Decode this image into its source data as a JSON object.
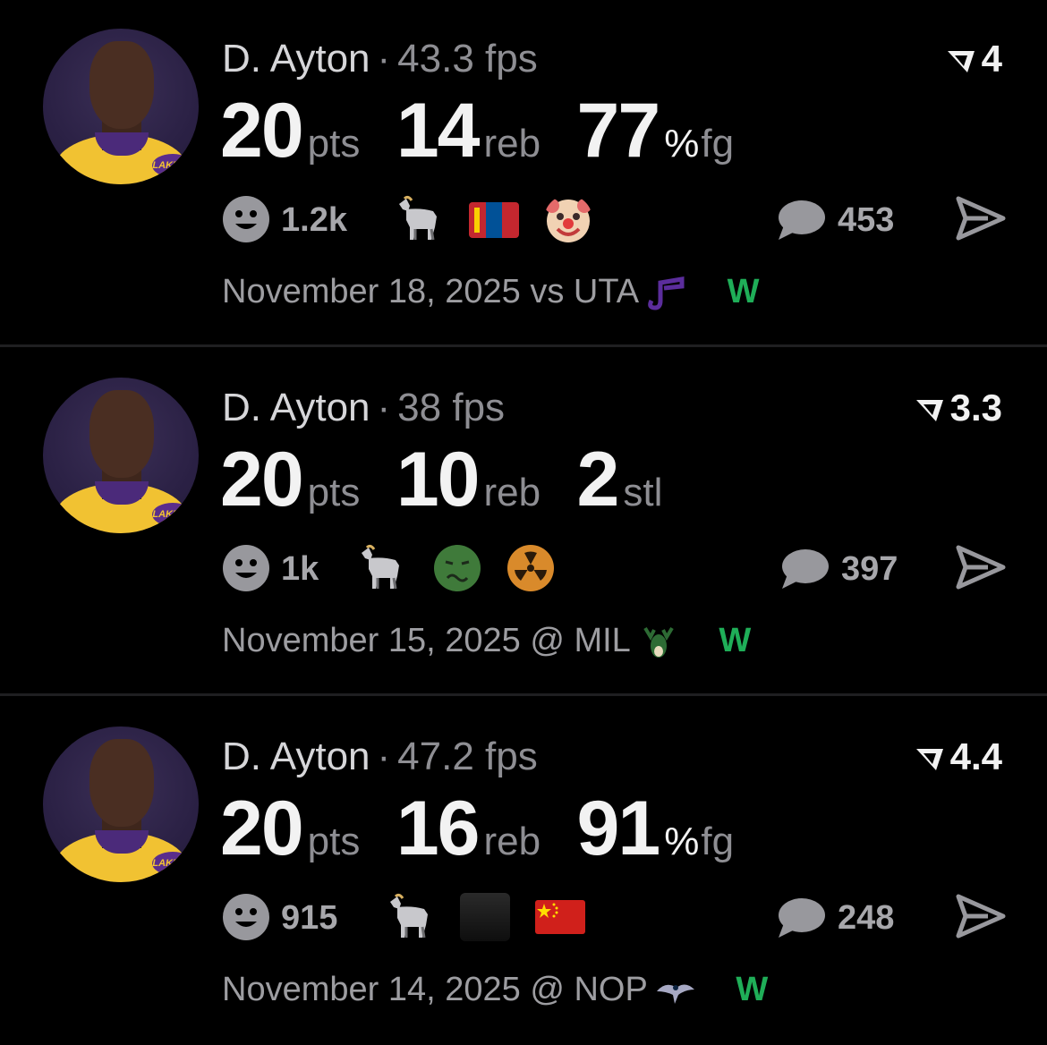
{
  "posts": [
    {
      "player": "D. Ayton",
      "separator": "·",
      "fps": "43.3 fps",
      "rank": "4",
      "stats": [
        {
          "value": "20",
          "unit": "pts"
        },
        {
          "value": "14",
          "unit": "reb"
        },
        {
          "value": "77",
          "pct": "%",
          "unit": "fg"
        }
      ],
      "reaction_count": "1.2k",
      "comment_count": "453",
      "date": "November 18, 2025",
      "matchup": "vs UTA",
      "result": "W"
    },
    {
      "player": "D. Ayton",
      "separator": "·",
      "fps": "38 fps",
      "rank": "3.3",
      "stats": [
        {
          "value": "20",
          "unit": "pts"
        },
        {
          "value": "10",
          "unit": "reb"
        },
        {
          "value": "2",
          "unit": "stl"
        }
      ],
      "reaction_count": "1k",
      "comment_count": "397",
      "date": "November 15, 2025",
      "matchup": "@ MIL",
      "result": "W"
    },
    {
      "player": "D. Ayton",
      "separator": "·",
      "fps": "47.2 fps",
      "rank": "4.4",
      "stats": [
        {
          "value": "20",
          "unit": "pts"
        },
        {
          "value": "16",
          "unit": "reb"
        },
        {
          "value": "91",
          "pct": "%",
          "unit": "fg"
        }
      ],
      "reaction_count": "915",
      "comment_count": "248",
      "date": "November 14, 2025",
      "matchup": "@ NOP",
      "result": "W"
    }
  ],
  "colors": {
    "background": "#000000",
    "primary_text": "#f2f2f2",
    "secondary_text": "#8e8e93",
    "win": "#1fae58"
  },
  "icons": [
    "smiley-icon",
    "goat-icon",
    "mongolia-flag-icon",
    "clown-face-icon",
    "nauseated-face-icon",
    "radioactive-icon",
    "photo-icon",
    "china-flag-icon",
    "comment-bubble-icon",
    "send-icon",
    "rank-triangle-icon",
    "jazz-logo",
    "bucks-logo",
    "pelicans-logo",
    "lakers-logo"
  ]
}
